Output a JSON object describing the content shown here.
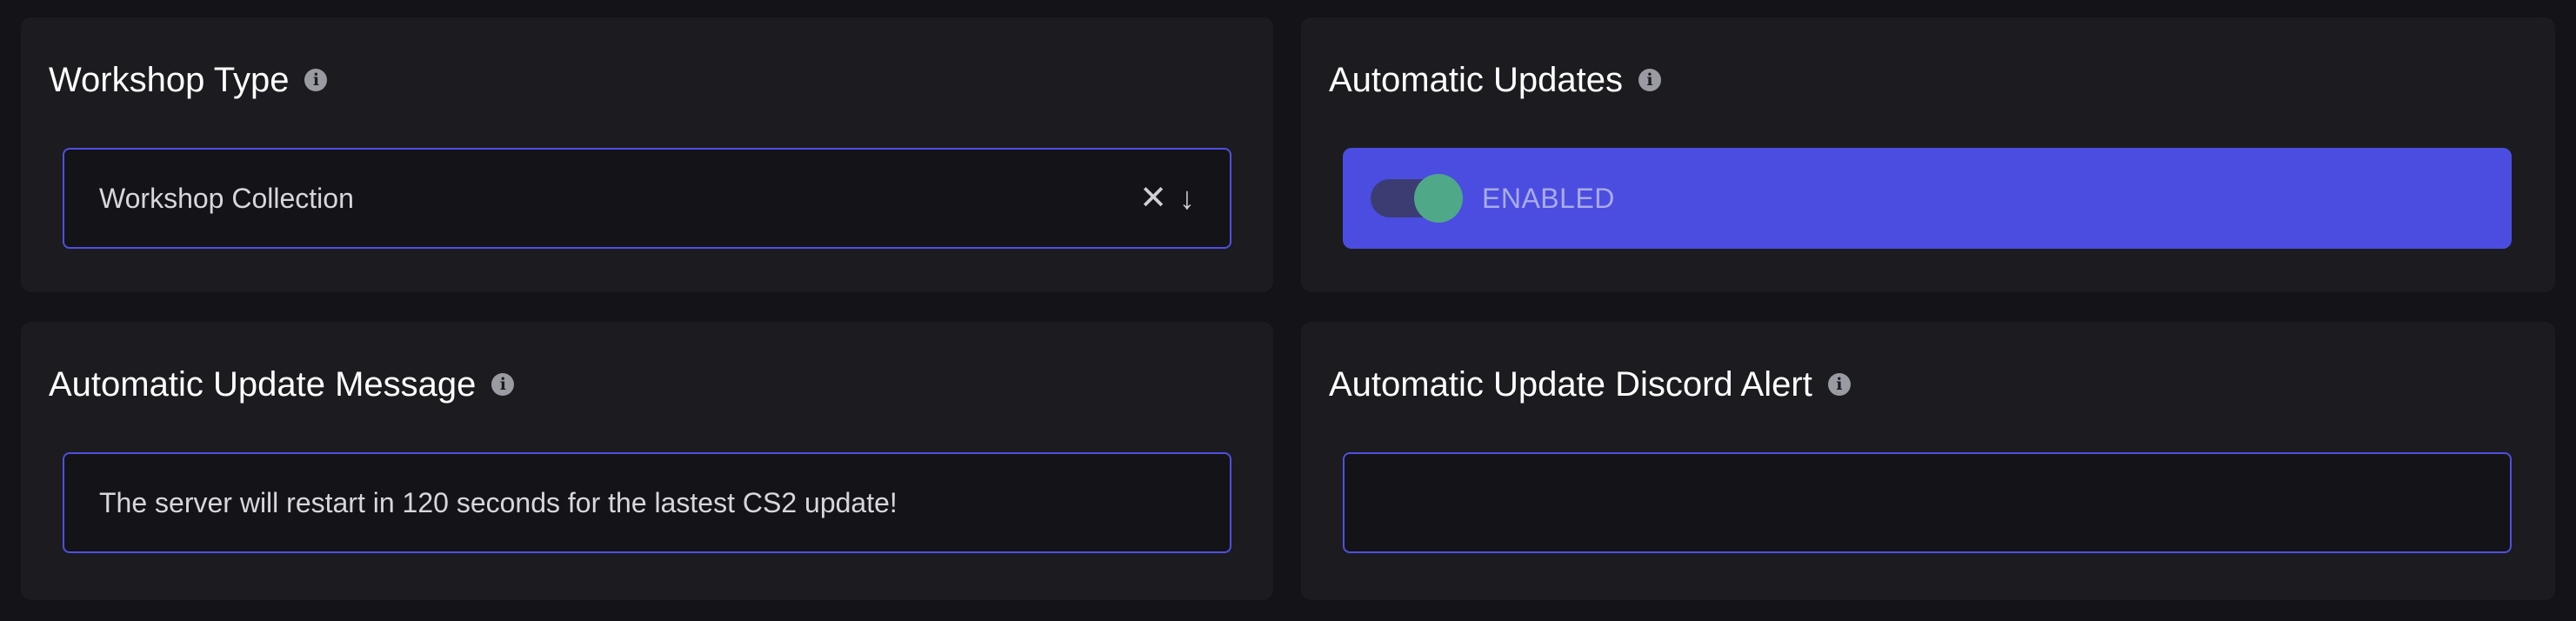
{
  "workshop_type": {
    "title": "Workshop Type",
    "info_icon": "info-icon",
    "selected_value": "Workshop Collection",
    "clear_symbol": "✕",
    "dropdown_symbol": "↓"
  },
  "automatic_updates": {
    "title": "Automatic Updates",
    "info_icon": "info-icon",
    "enabled": true,
    "state_label": "ENABLED"
  },
  "update_message": {
    "title": "Automatic Update Message",
    "info_icon": "info-icon",
    "value": "The server will restart in 120 seconds for the lastest CS2 update!"
  },
  "discord_alert": {
    "title": "Automatic Update Discord Alert",
    "info_icon": "info-icon",
    "value": ""
  },
  "colors": {
    "background": "#141418",
    "card": "#1c1c20",
    "accent": "#4a4de0",
    "field_border": "#4f4fe0",
    "toggle_knob": "#4fa888"
  }
}
